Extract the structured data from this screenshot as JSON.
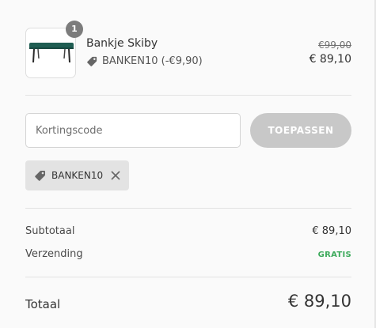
{
  "product": {
    "quantity": "1",
    "name": "Bankje Skiby",
    "discount_line": "BANKEN10 (-€9,90)",
    "original_price": "€99,00",
    "price": "€ 89,10",
    "image_icon": "bench-icon"
  },
  "discount_code": {
    "placeholder": "Kortingscode",
    "value": "",
    "apply_label": "TOEPASSEN",
    "applied_code": "BANKEN10"
  },
  "summary": {
    "subtotal_label": "Subtotaal",
    "subtotal_value": "€ 89,10",
    "shipping_label": "Verzending",
    "shipping_value": "GRATIS",
    "total_label": "Totaal",
    "total_value": "€ 89,10"
  },
  "colors": {
    "background": "#fafafa",
    "button_disabled": "#c8c8c8",
    "free_shipping": "#3daa5c",
    "product_teal": "#1f5d52"
  }
}
